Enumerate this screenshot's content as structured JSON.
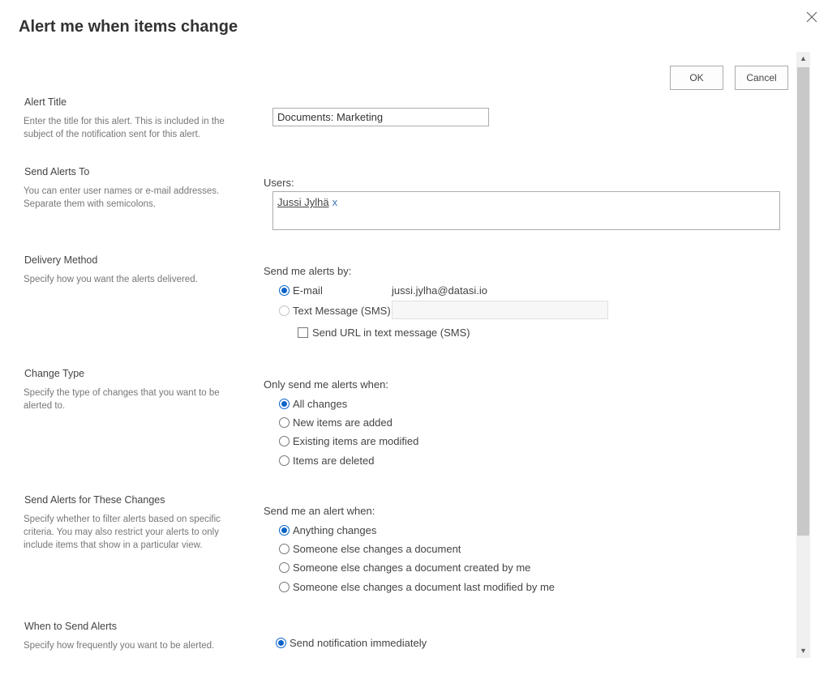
{
  "dialog": {
    "title": "Alert me when items change",
    "ok_label": "OK",
    "cancel_label": "Cancel"
  },
  "alert_title": {
    "heading": "Alert Title",
    "description": "Enter the title for this alert. This is included in the subject of the notification sent for this alert.",
    "value": "Documents: Marketing"
  },
  "send_to": {
    "heading": "Send Alerts To",
    "description": "You can enter user names or e-mail addresses. Separate them with semicolons.",
    "users_label": "Users:",
    "users": [
      {
        "name": "Jussi Jylhä",
        "remove": "x"
      }
    ]
  },
  "delivery": {
    "heading": "Delivery Method",
    "description": "Specify how you want the alerts delivered.",
    "label": "Send me alerts by:",
    "email_label": "E-mail",
    "email_address": "jussi.jylha@datasi.io",
    "sms_label": "Text Message (SMS)",
    "sms_value": "",
    "send_url_label": "Send URL in text message (SMS)",
    "selected": "E-mail"
  },
  "change_type": {
    "heading": "Change Type",
    "description": "Specify the type of changes that you want to be alerted to.",
    "label": "Only send me alerts when:",
    "options": [
      "All changes",
      "New items are added",
      "Existing items are modified",
      "Items are deleted"
    ],
    "selected": "All changes"
  },
  "filter": {
    "heading": "Send Alerts for These Changes",
    "description": "Specify whether to filter alerts based on specific criteria. You may also restrict your alerts to only include items that show in a particular view.",
    "label": "Send me an alert when:",
    "options": [
      "Anything changes",
      "Someone else changes a document",
      "Someone else changes a document created by me",
      "Someone else changes a document last modified by me"
    ],
    "selected": "Anything changes"
  },
  "when": {
    "heading": "When to Send Alerts",
    "description": "Specify how frequently you want to be alerted.",
    "options": [
      "Send notification immediately"
    ],
    "selected": "Send notification immediately"
  },
  "colors": {
    "accent": "#0a64c8",
    "link": "#3b73af"
  }
}
